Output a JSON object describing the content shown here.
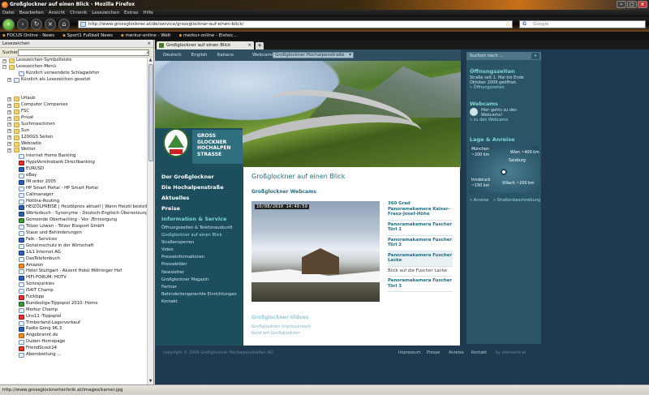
{
  "window": {
    "title": "Großglockner auf einen Blick - Mozilla Firefox"
  },
  "menu": [
    "Datei",
    "Bearbeiten",
    "Ansicht",
    "Chronik",
    "Lesezeichen",
    "Extras",
    "Hilfe"
  ],
  "nav": {
    "url": "http://www.grossglockner.at/de/service/grossglockner-auf-einen-blick/",
    "search_placeholder": "Google",
    "search_engine_icon": "G"
  },
  "bookmarks_toolbar": [
    "FOCUS Online - News",
    "Sport1 Fußball News",
    "merkur-online - Welt",
    "merkur-online - Eishoc..."
  ],
  "sidebar": {
    "title": "Lesezeichen",
    "search_label": "Suchen:",
    "rows": [
      {
        "label": "Lesezeichen-Symbolleiste",
        "indent": 1,
        "toggle": "+",
        "icon": "folder"
      },
      {
        "label": "Lesezeichen-Menü",
        "indent": 1,
        "toggle": "−",
        "icon": "folder"
      },
      {
        "label": "Kürzlich verwendete Schlagwörter",
        "indent": 3,
        "toggle": "",
        "icon": "page"
      },
      {
        "label": "Kürzlich als Lesezeichen gesetzt",
        "indent": 2,
        "toggle": "+",
        "icon": "page"
      },
      {
        "label": "",
        "indent": 0,
        "toggle": "",
        "icon": ""
      },
      {
        "label": "",
        "indent": 0,
        "toggle": "",
        "icon": ""
      },
      {
        "label": "Urlaub",
        "indent": 2,
        "toggle": "+",
        "icon": "folder"
      },
      {
        "label": "Computer Companies",
        "indent": 2,
        "toggle": "+",
        "icon": "folder"
      },
      {
        "label": "FSC",
        "indent": 2,
        "toggle": "+",
        "icon": "folder"
      },
      {
        "label": "Privat",
        "indent": 2,
        "toggle": "+",
        "icon": "folder"
      },
      {
        "label": "Suchmaschinen",
        "indent": 2,
        "toggle": "+",
        "icon": "folder"
      },
      {
        "label": "Sun",
        "indent": 2,
        "toggle": "+",
        "icon": "folder"
      },
      {
        "label": "1200GS Seiten",
        "indent": 2,
        "toggle": "+",
        "icon": "folder"
      },
      {
        "label": "Webradio",
        "indent": 2,
        "toggle": "+",
        "icon": "folder"
      },
      {
        "label": "Wetter",
        "indent": 2,
        "toggle": "+",
        "icon": "folder"
      },
      {
        "label": "Internet Home Banking",
        "indent": 3,
        "toggle": "",
        "icon": "page"
      },
      {
        "label": "HypoVereinsbank Directbanking",
        "indent": 3,
        "toggle": "",
        "icon": "red"
      },
      {
        "label": "EURUSD",
        "indent": 3,
        "toggle": "",
        "icon": "blue"
      },
      {
        "label": "eBay",
        "indent": 3,
        "toggle": "",
        "icon": "page"
      },
      {
        "label": "IM.order 2005",
        "indent": 3,
        "toggle": "",
        "icon": "blue"
      },
      {
        "label": "HP Smart Portal - HP Smart Portal",
        "indent": 3,
        "toggle": "",
        "icon": "page"
      },
      {
        "label": "Callmanager",
        "indent": 3,
        "toggle": "",
        "icon": "page"
      },
      {
        "label": "Hotline-Routing",
        "indent": 3,
        "toggle": "",
        "icon": "page"
      },
      {
        "label": "HEIZÖLPREISE | Heizölpreis aktuell | Wann Heizöl bestellen",
        "indent": 3,
        "toggle": "",
        "icon": "blue"
      },
      {
        "label": "Wörterbuch - Synonyme - Deutsch-Englisch Übersetzungen",
        "indent": 3,
        "toggle": "",
        "icon": "blue"
      },
      {
        "label": "Gemeinde Oberhaching - Ver- /Entsorgung",
        "indent": 3,
        "toggle": "",
        "icon": "green"
      },
      {
        "label": "Tölzer Löwen - Tölzer Eissport GmbH",
        "indent": 3,
        "toggle": "",
        "icon": "page"
      },
      {
        "label": "Staus und Behinderungen",
        "indent": 3,
        "toggle": "",
        "icon": "page"
      },
      {
        "label": "Falk - Services",
        "indent": 3,
        "toggle": "",
        "icon": "blue"
      },
      {
        "label": "Geheimschutz in der Wirtschaft",
        "indent": 3,
        "toggle": "",
        "icon": "page"
      },
      {
        "label": "1&1 Internet AG",
        "indent": 3,
        "toggle": "",
        "icon": "blue"
      },
      {
        "label": "DasTelefonbuch",
        "indent": 3,
        "toggle": "",
        "icon": "page"
      },
      {
        "label": "Amazon",
        "indent": 3,
        "toggle": "",
        "icon": "orange"
      },
      {
        "label": "Hotel Stuttgart - Akzent Hotel Möhringer Hof",
        "indent": 3,
        "toggle": "",
        "icon": "page"
      },
      {
        "label": "HIFI-FORUM: HDTV",
        "indent": 3,
        "toggle": "",
        "icon": "blue"
      },
      {
        "label": "Seriesjunkies",
        "indent": 3,
        "toggle": "",
        "icon": "page"
      },
      {
        "label": "IS4IT Champ",
        "indent": 3,
        "toggle": "",
        "icon": "page"
      },
      {
        "label": "Fuckbpp",
        "indent": 3,
        "toggle": "",
        "icon": "red"
      },
      {
        "label": "Bundesliga-Tippspiel 2010: Home",
        "indent": 3,
        "toggle": "",
        "icon": "green"
      },
      {
        "label": "Merkur Champ",
        "indent": 3,
        "toggle": "",
        "icon": "page"
      },
      {
        "label": "Uns11 -Tippspiel",
        "indent": 3,
        "toggle": "",
        "icon": "red"
      },
      {
        "label": "Timberland-Lagerverkauf",
        "indent": 3,
        "toggle": "",
        "icon": "page"
      },
      {
        "label": "Radio Gong 96,3",
        "indent": 3,
        "toggle": "",
        "icon": "blue"
      },
      {
        "label": "Angebrannt.de",
        "indent": 3,
        "toggle": "",
        "icon": "orange"
      },
      {
        "label": "Duden-Homepage",
        "indent": 3,
        "toggle": "",
        "icon": "page"
      },
      {
        "label": "FriendScout24",
        "indent": 3,
        "toggle": "",
        "icon": "red"
      },
      {
        "label": "Abendzeitung ...",
        "indent": 3,
        "toggle": "",
        "icon": "page"
      }
    ]
  },
  "tab": {
    "label": "Großglockner auf einen Blick",
    "close": "×",
    "new": "+"
  },
  "site": {
    "languages": [
      "Deutsch",
      "English",
      "Italiano"
    ],
    "webcam_link": "Webcameras",
    "select_value": "Großglockner Hochalpenstraße",
    "brand_lines": [
      "GROSS",
      "GLOCKNER",
      "HOCHALPEN",
      "STRASSE"
    ],
    "main_nav": [
      {
        "label": "Der Großglockner",
        "type": "m"
      },
      {
        "label": "Die Hochalpenstraße",
        "type": "m"
      },
      {
        "label": "Aktuelles",
        "type": "m"
      },
      {
        "label": "Preise",
        "type": "m"
      },
      {
        "label": "Information & Service",
        "type": "m act"
      },
      {
        "label": "Öffnungszeiten & Telefonauskunft",
        "type": "s"
      },
      {
        "label": "Großglockner auf einen Blick",
        "type": "s act"
      },
      {
        "label": "Straßensperren",
        "type": "s"
      },
      {
        "label": "Video",
        "type": "s"
      },
      {
        "label": "Presseinformationen",
        "type": "s"
      },
      {
        "label": "Pressebilder",
        "type": "s"
      },
      {
        "label": "Newsletter",
        "type": "s"
      },
      {
        "label": "Großglockner Magazin",
        "type": "s"
      },
      {
        "label": "Partner",
        "type": "s"
      },
      {
        "label": "Behindertengerechte Einrichtungen",
        "type": "s"
      },
      {
        "label": "Kontakt",
        "type": "s"
      }
    ],
    "heading": "Großglockner auf einen Blick",
    "webcams_title": "Großglockner Webcams",
    "webcam_timestamp": "10/08/2010 14:49:59",
    "cam_list": [
      {
        "label": "360 Grad Panoramakamera Kaiser-Franz-Josef-Höhe",
        "cls": "c"
      },
      {
        "label": "Panoramakamera Fuscher Törl 1",
        "cls": "c"
      },
      {
        "label": "Panoramakamera Fuscher Törl 2",
        "cls": "c"
      },
      {
        "label": "Panoramakamera Fuscher Lacke",
        "cls": "c hl"
      },
      {
        "label": "Blick auf die Fuscher Lacke",
        "cls": "c sub"
      },
      {
        "label": "Panoramakamera Fuscher Törl 3",
        "cls": "c"
      }
    ],
    "videos_title": "Großglockner-Videos",
    "video_links": [
      "Großglockner Impressionen",
      "Gold am Großglockner"
    ],
    "footer_copy": "copyright © 2009 Großglockner Hochalpenstraßen AG",
    "footer_links": [
      "Impressum",
      "Presse",
      "Anreise",
      "Kontakt"
    ],
    "footer_credit": "by elements.at",
    "right": {
      "search_placeholder": "Suchen nach ...",
      "search_go": "»",
      "open_title": "Öffnungszeiten",
      "open_text": "Straße seit 1. Mai bis Ende Oktober 2009 geöffnet.",
      "open_link": "» Öffnungszeiten",
      "webcams_title": "Webcams",
      "webcams_text": "Hier gehts zu den Webcams!",
      "webcams_link": "» zu den Webcams",
      "location_title": "Lage & Anreise",
      "map_places": [
        "München",
        "~200 km",
        "Wien ~400 km",
        "Salzburg",
        "Innsbruck",
        "~150 km",
        "Villach ~200 km"
      ],
      "map_links": [
        "» Anreise",
        "» Straßenbeschreibung"
      ]
    }
  },
  "status": {
    "text": "http://www.grossglocknertechnik.at/images/kamer.jpg"
  }
}
